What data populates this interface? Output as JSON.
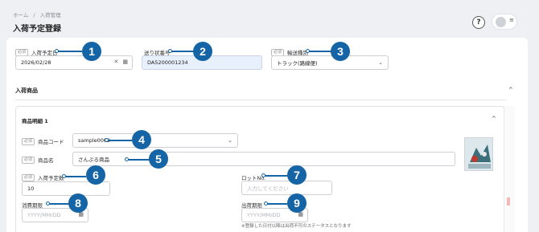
{
  "breadcrumb": [
    "ホーム",
    "/",
    "入荷管理"
  ],
  "page_title": "入荷予定登録",
  "header": {
    "help_glyph": "?",
    "menu_glyph": "≡"
  },
  "required_badge": "必須",
  "form": {
    "arrival_date": {
      "label": "入荷予定日",
      "value": "2026/02/28"
    },
    "slip_no": {
      "label": "送り状番号",
      "value": "DA5200001234"
    },
    "transport": {
      "label": "輸送種別",
      "value": "トラック(路線便)"
    }
  },
  "section": {
    "title": "入荷商品",
    "toggle": "^"
  },
  "item": {
    "title": "商品明細 1",
    "toggle": "^",
    "product_code": {
      "label": "商品コード",
      "value": "sample0002"
    },
    "product_name": {
      "label": "商品名",
      "value": "さんぷる商品"
    },
    "quantity": {
      "label": "入荷予定数",
      "value": "10"
    },
    "lot_no": {
      "label": "ロットNo.",
      "placeholder": "入力してください"
    },
    "expiry": {
      "label": "消費期限",
      "placeholder": "YYYY/MM/DD"
    },
    "ship_limit": {
      "label": "出荷期限",
      "placeholder": "YYYY/MM/DD"
    },
    "note": "※登録した日付以降は出荷不可のステータスとなります"
  },
  "callouts": [
    "1",
    "2",
    "3",
    "4",
    "5",
    "6",
    "7",
    "8",
    "9"
  ],
  "colors": {
    "callout": "#1565a6",
    "readonly_bg": "#e8f0fb"
  }
}
